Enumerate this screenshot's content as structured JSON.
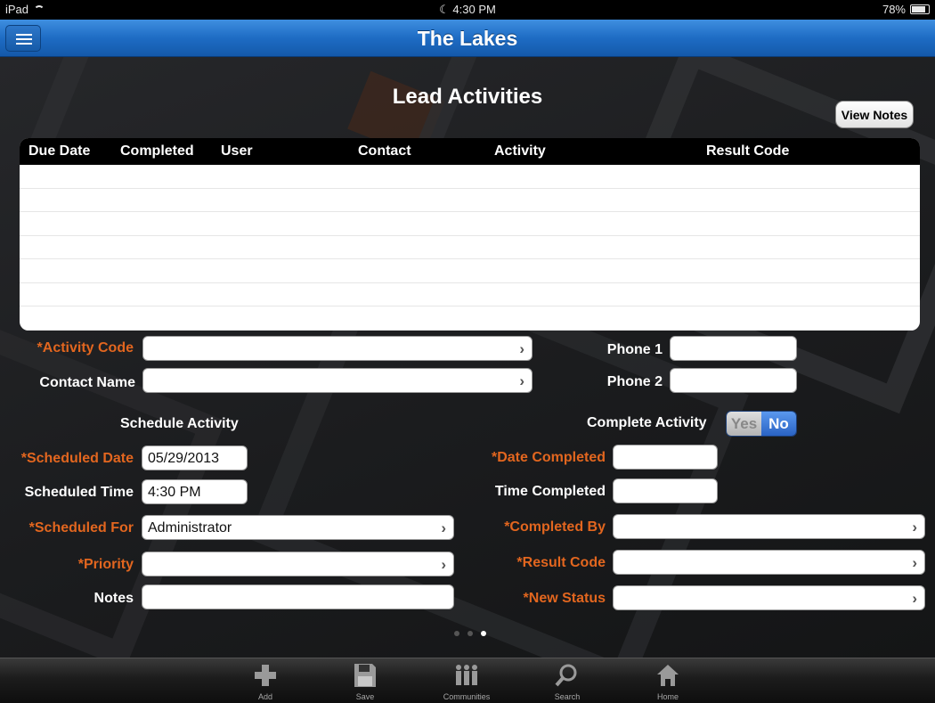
{
  "status_bar": {
    "device": "iPad",
    "time": "4:30 PM",
    "battery": "78%"
  },
  "nav": {
    "title": "The Lakes"
  },
  "page": {
    "heading": "Lead Activities",
    "view_notes": "View Notes"
  },
  "table": {
    "columns": [
      "Due Date",
      "Completed",
      "User",
      "Contact",
      "Activity",
      "Result Code"
    ],
    "rows": []
  },
  "form": {
    "activity_code": {
      "label": "*Activity Code",
      "value": ""
    },
    "contact_name": {
      "label": "Contact Name",
      "value": ""
    },
    "phone1": {
      "label": "Phone 1",
      "value": ""
    },
    "phone2": {
      "label": "Phone 2",
      "value": ""
    },
    "schedule_title": "Schedule Activity",
    "scheduled_date": {
      "label": "*Scheduled Date",
      "value": "05/29/2013"
    },
    "scheduled_time": {
      "label": "Scheduled Time",
      "value": "4:30 PM"
    },
    "scheduled_for": {
      "label": "*Scheduled For",
      "value": "Administrator"
    },
    "priority": {
      "label": "*Priority",
      "value": ""
    },
    "notes": {
      "label": "Notes",
      "value": ""
    },
    "complete_activity": {
      "label": "Complete Activity",
      "yes": "Yes",
      "no": "No",
      "selected": "No"
    },
    "date_completed": {
      "label": "*Date Completed",
      "value": ""
    },
    "time_completed": {
      "label": "Time Completed",
      "value": ""
    },
    "completed_by": {
      "label": "*Completed By",
      "value": ""
    },
    "result_code": {
      "label": "*Result Code",
      "value": ""
    },
    "new_status": {
      "label": "*New Status",
      "value": ""
    }
  },
  "page_indicator": {
    "count": 3,
    "active": 3
  },
  "tabbar": [
    {
      "label": "Add",
      "icon": "plus-icon"
    },
    {
      "label": "Save",
      "icon": "floppy-disk-icon"
    },
    {
      "label": "Communities",
      "icon": "people-icon"
    },
    {
      "label": "Search",
      "icon": "magnifier-icon"
    },
    {
      "label": "Home",
      "icon": "house-icon"
    }
  ],
  "colors": {
    "nav_blue": "#1e6cc4",
    "required_label": "#e2661f",
    "toggle_on": "#2a63c4"
  }
}
